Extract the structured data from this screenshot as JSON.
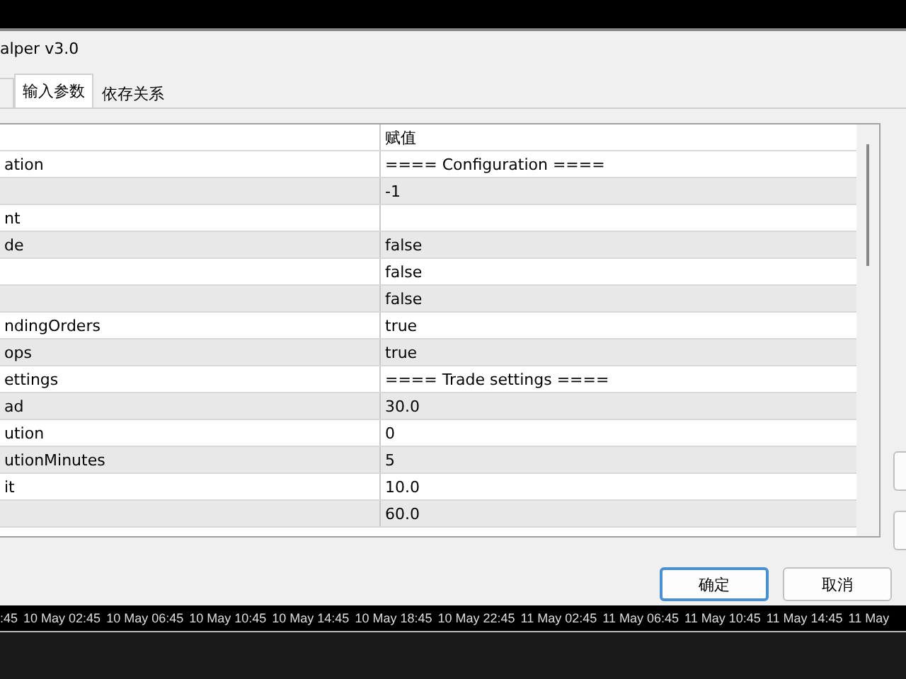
{
  "window": {
    "title": "alper v3.0"
  },
  "tabs": [
    {
      "label": "输入参数",
      "selected": true
    },
    {
      "label": "依存关系",
      "selected": false
    }
  ],
  "table": {
    "value_header": "赋值",
    "rows": [
      {
        "name": "ation",
        "value": "==== Configuration ===="
      },
      {
        "value": "-1"
      },
      {
        "name": "nt",
        "value": ""
      },
      {
        "name": "de",
        "value": "false"
      },
      {
        "value": "false"
      },
      {
        "value": "false"
      },
      {
        "name": "ndingOrders",
        "value": "true"
      },
      {
        "name": "ops",
        "value": "true"
      },
      {
        "name": "ettings",
        "value": "==== Trade settings ===="
      },
      {
        "name": "ad",
        "value": "30.0"
      },
      {
        "name": "ution",
        "value": "0"
      },
      {
        "name": "utionMinutes",
        "value": "5"
      },
      {
        "name": "it",
        "value": "10.0"
      },
      {
        "value": "60.0"
      }
    ]
  },
  "buttons": [
    "确定",
    "取消"
  ],
  "timeline": [
    ":45",
    "10 May 02:45",
    "10 May 06:45",
    "10 May 10:45",
    "10 May 14:45",
    "10 May 18:45",
    "10 May 22:45",
    "11 May 02:45",
    "11 May 06:45",
    "11 May 10:45",
    "11 May 14:45",
    "11 May"
  ]
}
